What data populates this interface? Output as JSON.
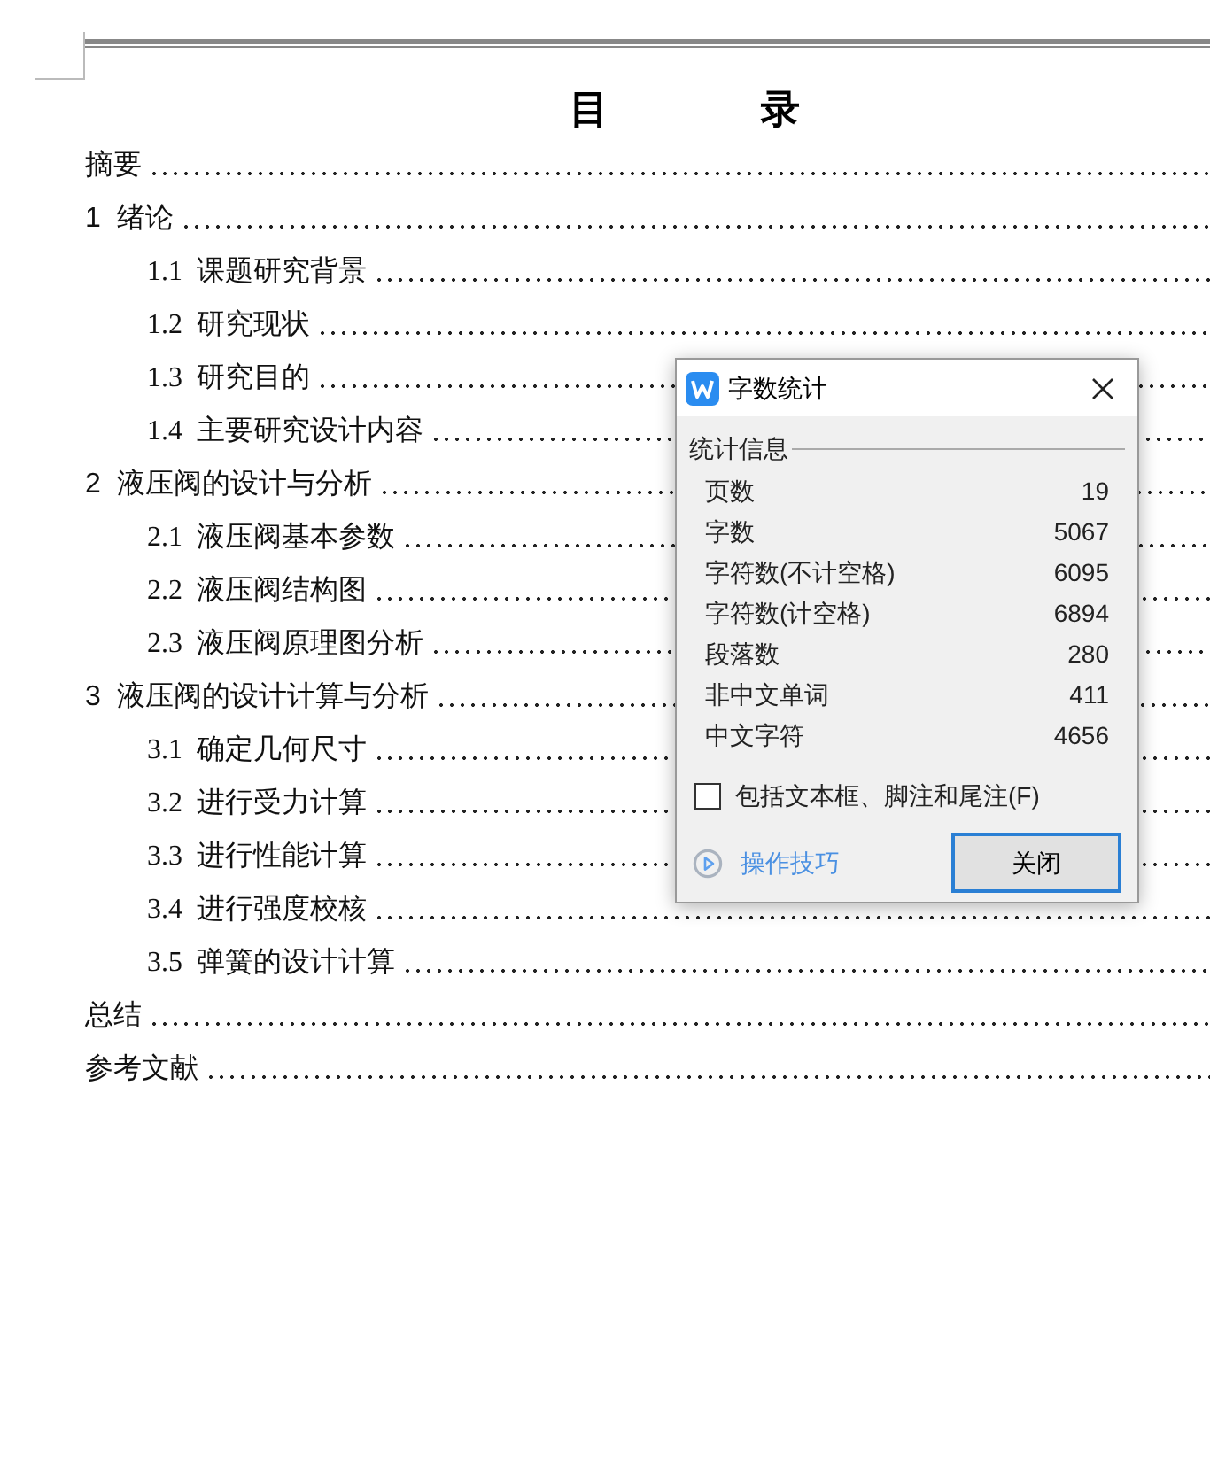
{
  "document": {
    "title": "目 录",
    "toc": [
      {
        "text": "摘要"
      },
      {
        "text": "1  绪论",
        "children": [
          {
            "text": "1.1  课题研究背景"
          },
          {
            "text": "1.2  研究现状"
          },
          {
            "text": "1.3  研究目的"
          },
          {
            "text": "1.4  主要研究设计内容"
          }
        ]
      },
      {
        "text": "2  液压阀的设计与分析",
        "children": [
          {
            "text": "2.1  液压阀基本参数"
          },
          {
            "text": "2.2  液压阀结构图"
          },
          {
            "text": "2.3  液压阀原理图分析"
          }
        ]
      },
      {
        "text": "3  液压阀的设计计算与分析",
        "children": [
          {
            "text": "3.1  确定几何尺寸"
          },
          {
            "text": "3.2  进行受力计算"
          },
          {
            "text": "3.3  进行性能计算"
          },
          {
            "text": "3.4  进行强度校核"
          },
          {
            "text": "3.5  弹簧的设计计算"
          }
        ]
      },
      {
        "text": "总结"
      },
      {
        "text": "参考文献"
      }
    ]
  },
  "dialog": {
    "title": "字数统计",
    "group": "统计信息",
    "stats": [
      {
        "label": "页数",
        "value": "19"
      },
      {
        "label": "字数",
        "value": "5067"
      },
      {
        "label": "字符数(不计空格)",
        "value": "6095"
      },
      {
        "label": "字符数(计空格)",
        "value": "6894"
      },
      {
        "label": "段落数",
        "value": "280"
      },
      {
        "label": "非中文单词",
        "value": "411"
      },
      {
        "label": "中文字符",
        "value": "4656"
      }
    ],
    "checkbox": {
      "label": "包括文本框、脚注和尾注(F)",
      "checked": false
    },
    "tips_link": "操作技巧",
    "close_button": "关闭"
  }
}
